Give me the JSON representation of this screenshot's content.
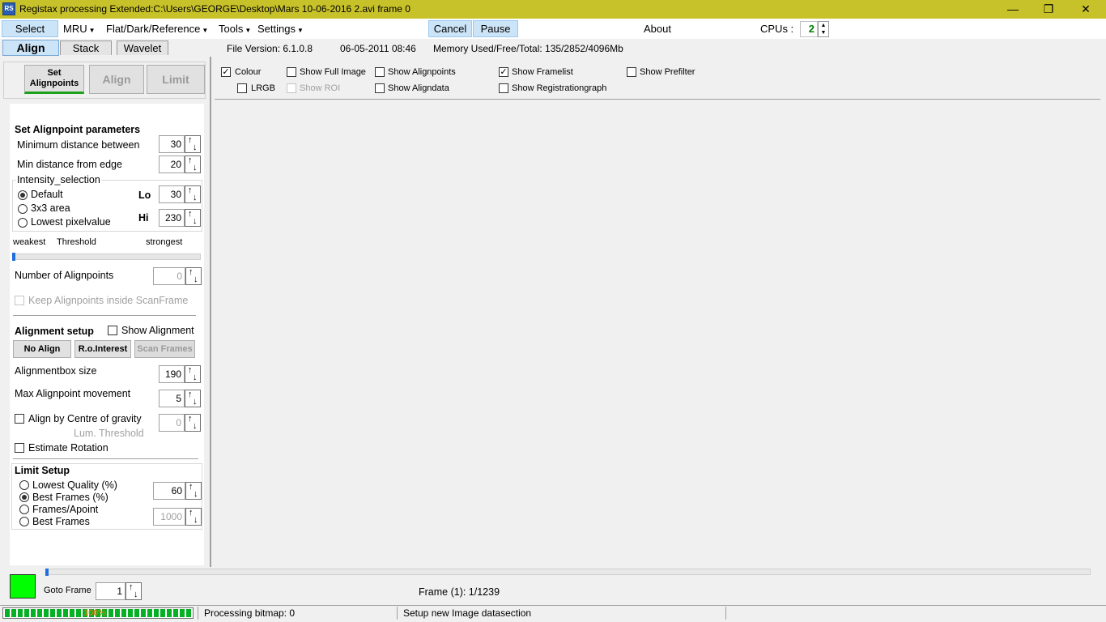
{
  "titlebar": {
    "title": "Registax processing Extended:C:\\Users\\GEORGE\\Desktop\\Mars 10-06-2016 2.avi frame 0",
    "icon_label": "RS",
    "minimize": "—",
    "restore": "❐",
    "close": "✕"
  },
  "menu": {
    "select": "Select",
    "mru": "MRU",
    "flat": "Flat/Dark/Reference",
    "tools": "Tools",
    "settings": "Settings",
    "cancel": "Cancel",
    "pause": "Pause",
    "about": "About",
    "cpus_label": "CPUs :",
    "cpus_value": "2"
  },
  "tabs": {
    "align": "Align",
    "stack": "Stack",
    "wavelet": "Wavelet"
  },
  "info": {
    "file_version": "File Version: 6.1.0.8",
    "date": "06-05-2011 08:46",
    "memory": "Memory Used/Free/Total: 135/2852/4096Mb"
  },
  "left": {
    "buttons": {
      "set": "Set Alignpoints",
      "align": "Align",
      "limit": "Limit"
    },
    "set_params_title": "Set Alignpoint parameters",
    "min_distance_label": "Minimum distance between",
    "min_distance_value": "30",
    "min_edge_label": "Min distance from edge",
    "min_edge_value": "20",
    "intensity_title": "Intensity_selection",
    "radio_default": "Default",
    "radio_3x3": "3x3 area",
    "radio_lowest": "Lowest pixelvalue",
    "lo_label": "Lo",
    "lo_value": "30",
    "hi_label": "Hi",
    "hi_value": "230",
    "weakest": "weakest",
    "threshold": "Threshold",
    "strongest": "strongest",
    "threshold_level": 0.0,
    "num_alignpoints_label": "Number of Alignpoints",
    "num_alignpoints_value": "0",
    "keep_inside_label": "Keep Alignpoints inside ScanFrame",
    "alignment_setup_title": "Alignment setup",
    "show_alignment_label": "Show Alignment",
    "no_align": "No Align",
    "roi": "R.o.Interest",
    "scan_frames": "Scan Frames",
    "alignbox_label": "Alignmentbox size",
    "alignbox_value": "190",
    "max_move_label": "Max Alignpoint movement",
    "max_move_value": "5",
    "centre_gravity_label": "Align by Centre of gravity",
    "centre_gravity_value": "0",
    "lum_threshold_label": "Lum. Threshold",
    "estimate_rotation_label": "Estimate Rotation",
    "limit_title": "Limit Setup",
    "radio_lowest_quality": "Lowest Quality (%)",
    "radio_best_frames_pct": "Best Frames (%)",
    "radio_frames_apoint": "Frames/Apoint",
    "radio_best_frames": "Best Frames",
    "limit_value1": "60",
    "limit_value2": "1000"
  },
  "image_options": {
    "colour": "Colour",
    "lrgb": "LRGB",
    "show_full_image": "Show Full Image",
    "show_roi": "Show ROI",
    "show_alignpoints": "Show Alignpoints",
    "show_aligndata": "Show Aligndata",
    "show_framelist": "Show Framelist",
    "show_registrationgraph": "Show Registrationgraph",
    "show_prefilter": "Show Prefilter"
  },
  "bottom": {
    "goto_frame_label": "Goto Frame",
    "goto_frame_value": "1",
    "frame_info": "Frame (1): 1/1239",
    "frame_position": 0.0
  },
  "status": {
    "progress_text": "100%",
    "progress_value": 1.0,
    "processing": "Processing bitmap: 0",
    "setup": "Setup new Image datasection"
  },
  "colors": {
    "titlebar": "#c8c22a",
    "accent": "#cce4f7",
    "progress_green": "#06b025",
    "swatch_green": "#00ff00"
  }
}
